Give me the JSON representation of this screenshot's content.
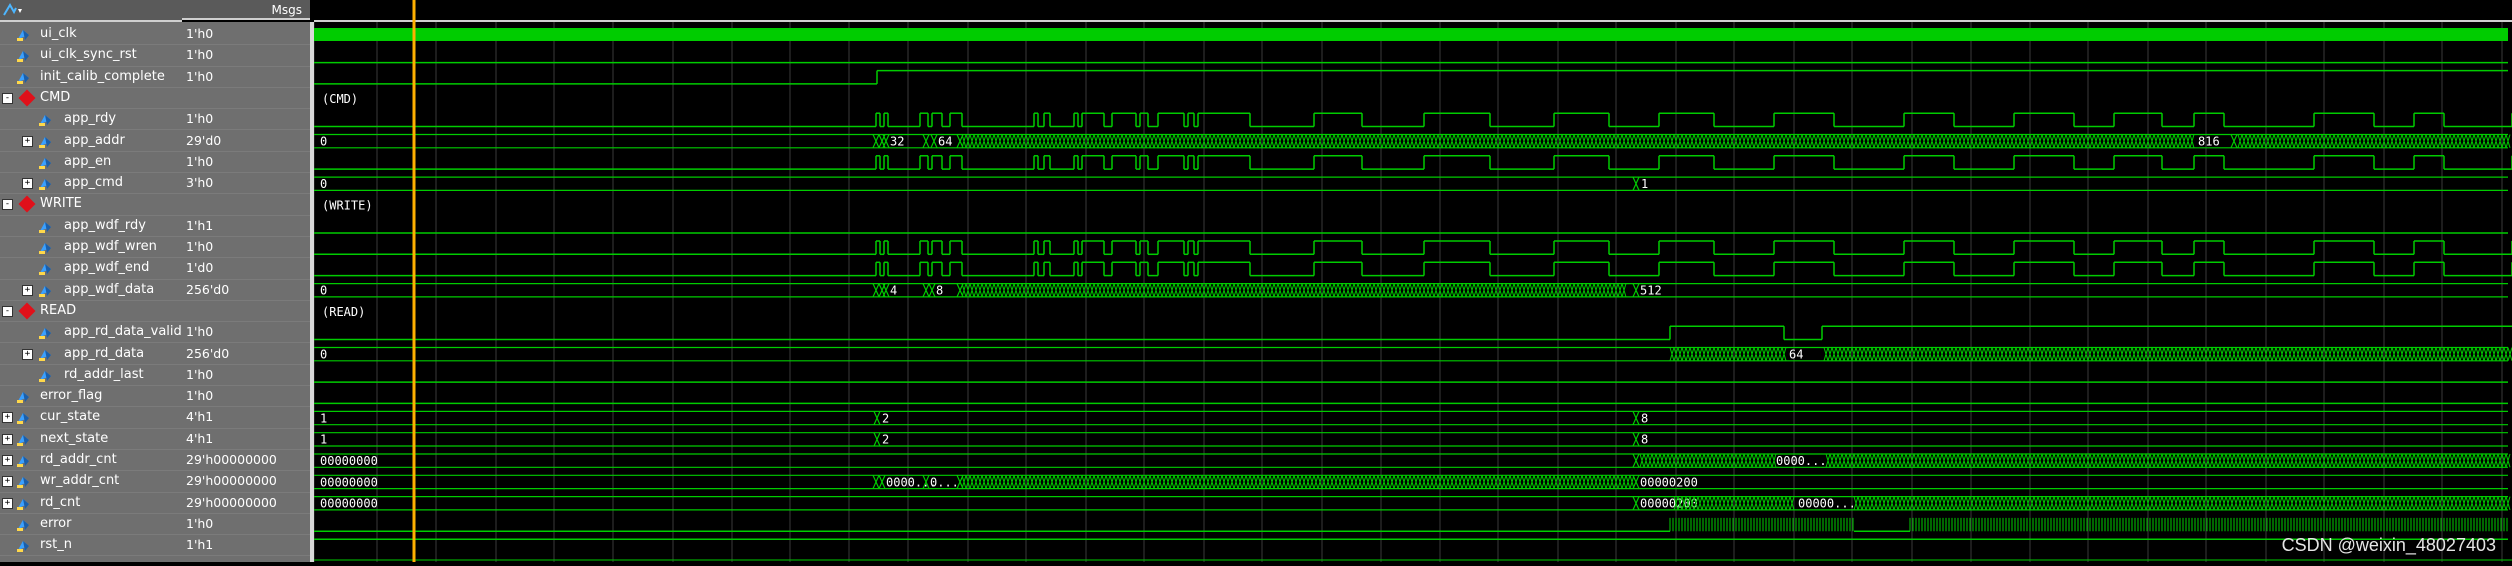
{
  "header": {
    "msgs_label": "Msgs"
  },
  "signals": [
    {
      "name": "ui_clk",
      "value": "1'h0",
      "kind": "signal",
      "indent": 1
    },
    {
      "name": "ui_clk_sync_rst",
      "value": "1'h0",
      "kind": "signal",
      "indent": 1
    },
    {
      "name": "init_calib_complete",
      "value": "1'h0",
      "kind": "signal",
      "indent": 1
    },
    {
      "name": "CMD",
      "value": "",
      "kind": "group",
      "indent": 0
    },
    {
      "name": "app_rdy",
      "value": "1'h0",
      "kind": "signal",
      "indent": 2
    },
    {
      "name": "app_addr",
      "value": "29'd0",
      "kind": "bus",
      "indent": 2
    },
    {
      "name": "app_en",
      "value": "1'h0",
      "kind": "signal",
      "indent": 2
    },
    {
      "name": "app_cmd",
      "value": "3'h0",
      "kind": "bus",
      "indent": 2
    },
    {
      "name": "WRITE",
      "value": "",
      "kind": "group",
      "indent": 0
    },
    {
      "name": "app_wdf_rdy",
      "value": "1'h1",
      "kind": "signal",
      "indent": 2
    },
    {
      "name": "app_wdf_wren",
      "value": "1'h0",
      "kind": "signal",
      "indent": 2
    },
    {
      "name": "app_wdf_end",
      "value": "1'd0",
      "kind": "signal",
      "indent": 2
    },
    {
      "name": "app_wdf_data",
      "value": "256'd0",
      "kind": "bus",
      "indent": 2
    },
    {
      "name": "READ",
      "value": "",
      "kind": "group",
      "indent": 0
    },
    {
      "name": "app_rd_data_valid",
      "value": "1'h0",
      "kind": "signal",
      "indent": 2
    },
    {
      "name": "app_rd_data",
      "value": "256'd0",
      "kind": "bus",
      "indent": 2
    },
    {
      "name": "rd_addr_last",
      "value": "1'h0",
      "kind": "signal",
      "indent": 2
    },
    {
      "name": "error_flag",
      "value": "1'h0",
      "kind": "signal",
      "indent": 1
    },
    {
      "name": "cur_state",
      "value": "4'h1",
      "kind": "bus",
      "indent": 1
    },
    {
      "name": "next_state",
      "value": "4'h1",
      "kind": "bus",
      "indent": 1
    },
    {
      "name": "rd_addr_cnt",
      "value": "29'h00000000",
      "kind": "bus",
      "indent": 1
    },
    {
      "name": "wr_addr_cnt",
      "value": "29'h00000000",
      "kind": "bus",
      "indent": 1
    },
    {
      "name": "rd_cnt",
      "value": "29'h00000000",
      "kind": "bus",
      "indent": 1
    },
    {
      "name": "error",
      "value": "1'h0",
      "kind": "signal",
      "indent": 1
    },
    {
      "name": "rst_n",
      "value": "1'h1",
      "kind": "signal",
      "indent": 1
    }
  ],
  "wave_labels": {
    "cmd_group": "(CMD)",
    "write_group": "(WRITE)",
    "read_group": "(READ)",
    "app_addr_init": "0",
    "app_addr_v1": "32",
    "app_addr_v2": "64",
    "app_addr_v3": "816",
    "app_cmd_init": "0",
    "app_cmd_v1": "1",
    "app_wdf_data_init": "0",
    "app_wdf_data_v1": "4",
    "app_wdf_data_v2": "8",
    "app_wdf_data_v3": "512",
    "app_rd_data_init": "0",
    "app_rd_data_v1": "64",
    "cur_state_init": "1",
    "cur_state_v1": "2",
    "cur_state_v2": "8",
    "next_state_init": "1",
    "next_state_v1": "2",
    "next_state_v2": "8",
    "rd_addr_cnt_init": "00000000",
    "rd_addr_cnt_v1": "0000...",
    "wr_addr_cnt_init": "00000000",
    "wr_addr_cnt_v1": "0000...",
    "wr_addr_cnt_v2": "0...",
    "wr_addr_cnt_v3": "00000200",
    "rd_cnt_init": "00000000",
    "rd_cnt_v1": "00000200",
    "rd_cnt_v2": "00000..."
  },
  "watermark": "CSDN @weixin_48027403",
  "colors": {
    "wave_green": "#00cc00",
    "cursor": "#ffb000",
    "panel": "#6f6f6f",
    "grid": "#3a3a3a"
  }
}
